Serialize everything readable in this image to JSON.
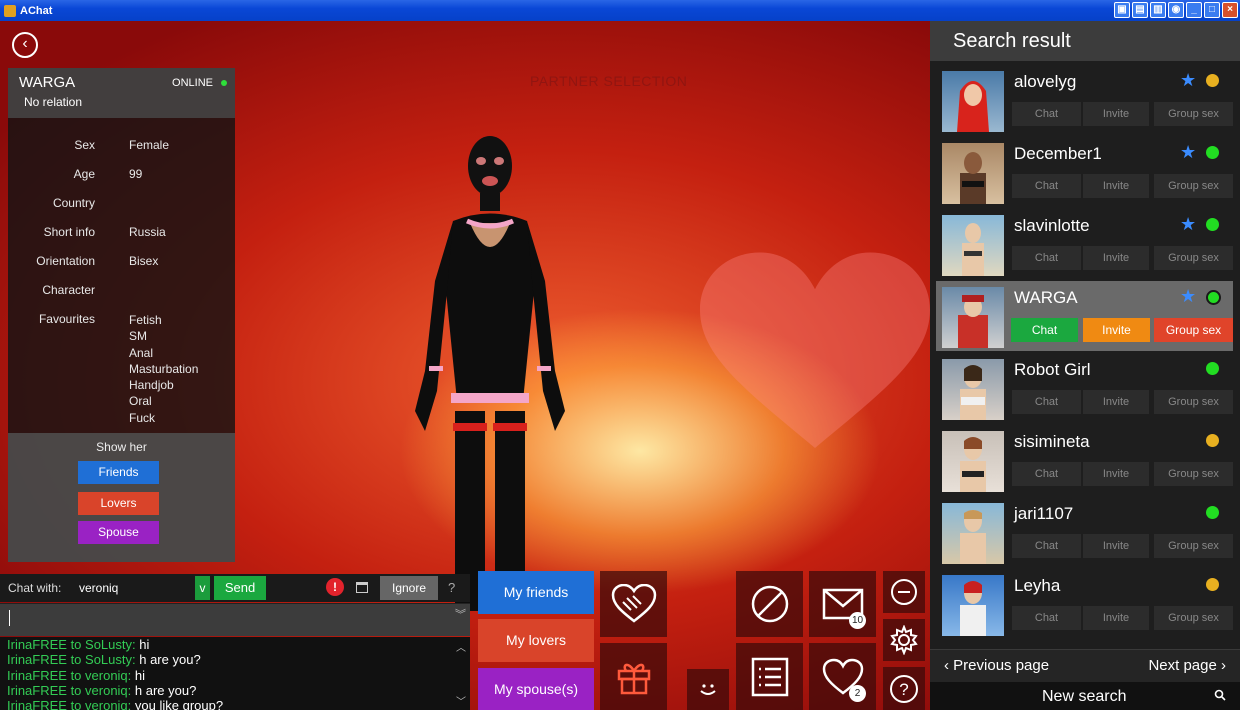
{
  "window": {
    "title": "AChat"
  },
  "scene": {
    "title": "PARTNER SELECTION"
  },
  "profile": {
    "name": "WARGA",
    "relation": "No relation",
    "status": "ONLINE",
    "fields": [
      {
        "label": "Sex",
        "value": "Female"
      },
      {
        "label": "Age",
        "value": "99"
      },
      {
        "label": "Country",
        "value": ""
      },
      {
        "label": "Short info",
        "value": "Russia"
      },
      {
        "label": "Orientation",
        "value": "Bisex"
      },
      {
        "label": "Character",
        "value": ""
      },
      {
        "label": "Favourites",
        "value": ""
      }
    ],
    "favourites": [
      "Fetish",
      "SM",
      "Anal",
      "Masturbation",
      "Handjob",
      "Oral",
      "Fuck"
    ],
    "show_her": {
      "title": "Show her",
      "buttons": [
        {
          "label": "Friends",
          "color": "#1f6fd6"
        },
        {
          "label": "Lovers",
          "color": "#d9442a"
        },
        {
          "label": "Spouse",
          "color": "#9a22c4"
        }
      ]
    }
  },
  "chat": {
    "with_label": "Chat with:",
    "with_value": "veroniq",
    "v_label": "v",
    "send_label": "Send",
    "alert_label": "!",
    "ignore_label": "Ignore",
    "help_label": "?",
    "messages": [
      {
        "from": "IrinaFREE to SoLusty:",
        "text": " hi"
      },
      {
        "from": "IrinaFREE to SoLusty:",
        "text": " h are you?"
      },
      {
        "from": "IrinaFREE to veroniq:",
        "text": " hi"
      },
      {
        "from": "IrinaFREE to veroniq:",
        "text": " h are you?"
      },
      {
        "from": "IrinaFREE to veroniq:",
        "text": " you like group?"
      }
    ]
  },
  "relations": [
    {
      "label": "My friends",
      "color": "#1f6fd6"
    },
    {
      "label": "My lovers",
      "color": "#d9442a"
    },
    {
      "label": "My spouse(s)",
      "color": "#9a22c4"
    }
  ],
  "tiles": {
    "messages_count": "10",
    "likes_count": "2"
  },
  "search": {
    "title": "Search result",
    "action_labels": {
      "chat": "Chat",
      "invite": "Invite",
      "group": "Group sex"
    },
    "colors": {
      "chat": "#1ba83f",
      "invite": "#f08a12",
      "group": "#e0442a",
      "online": "#22dd22",
      "away": "#e8b020"
    },
    "users": [
      {
        "name": "alovelyg",
        "status": "away",
        "favorite": true
      },
      {
        "name": "December1",
        "status": "online",
        "favorite": true
      },
      {
        "name": "slavinlotte",
        "status": "online",
        "favorite": true
      },
      {
        "name": "WARGA",
        "status": "online",
        "favorite": true,
        "selected": true
      },
      {
        "name": "Robot Girl",
        "status": "online",
        "favorite": false
      },
      {
        "name": "sisimineta",
        "status": "away",
        "favorite": false
      },
      {
        "name": "jari1107",
        "status": "online",
        "favorite": false
      },
      {
        "name": "Leyha",
        "status": "away",
        "favorite": false
      }
    ],
    "prev_label": "Previous page",
    "next_label": "Next page",
    "new_search_label": "New search"
  }
}
